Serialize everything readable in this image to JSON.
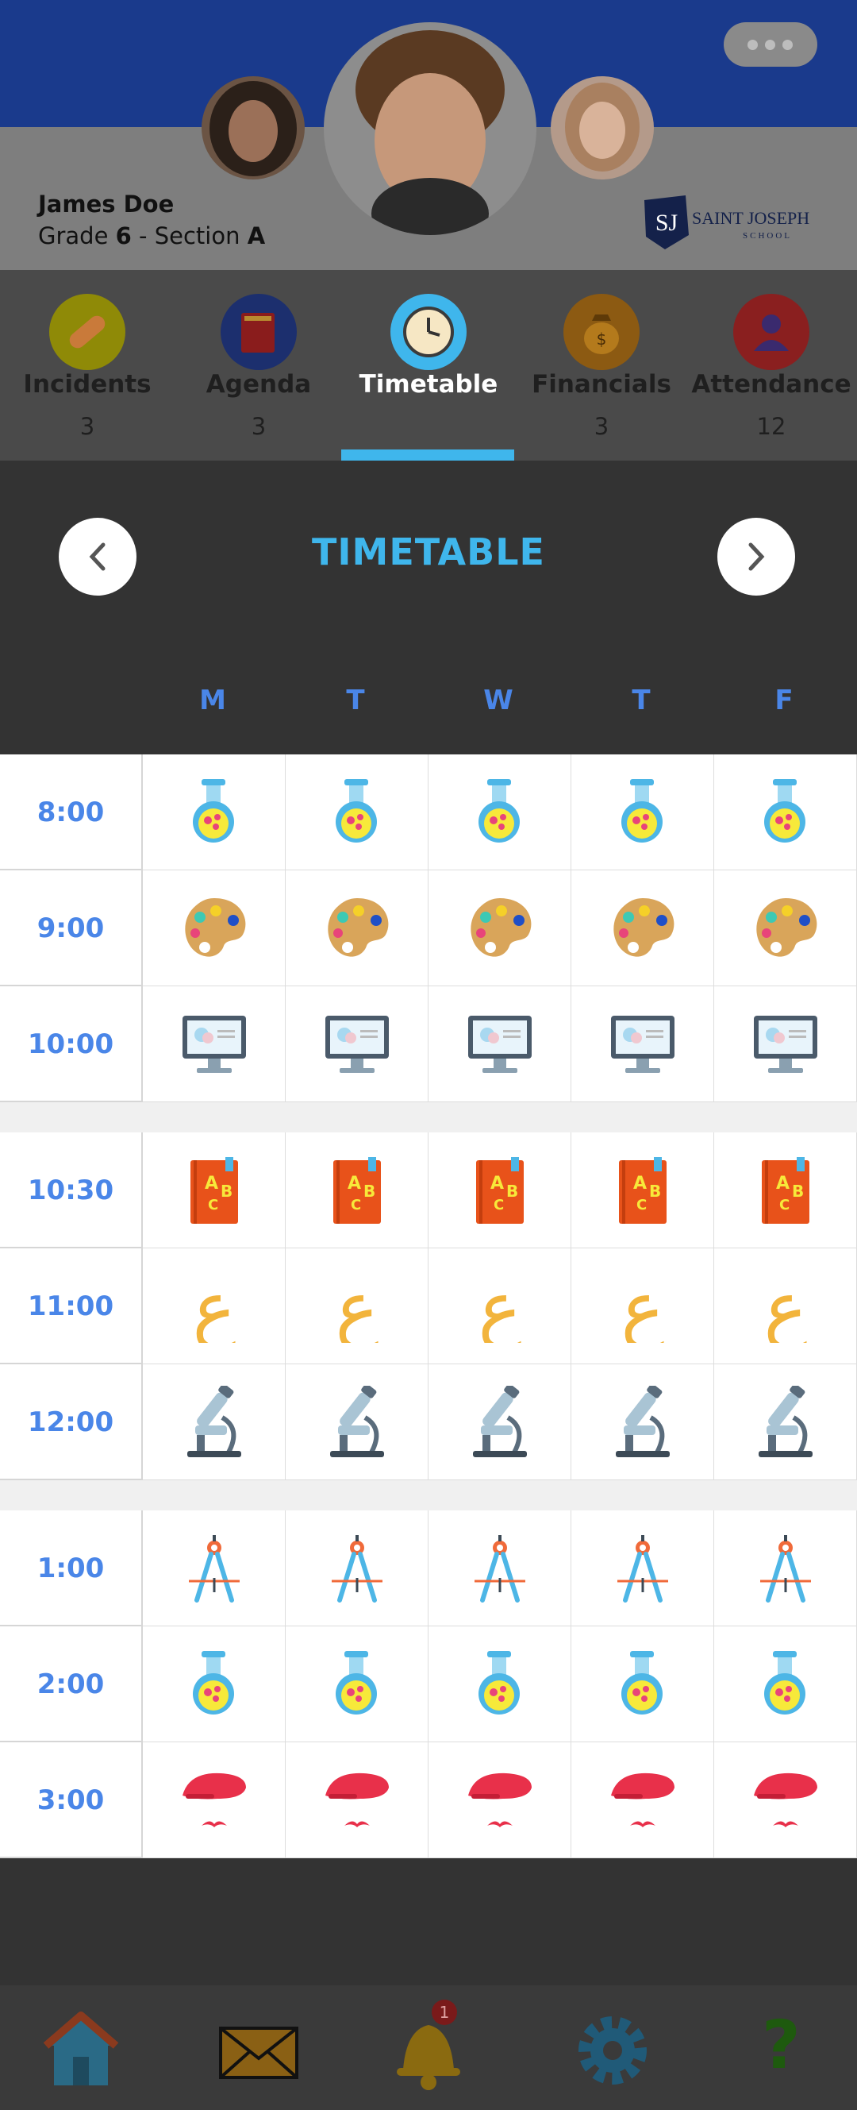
{
  "header": {
    "student_name": "James Doe",
    "grade_prefix": "Grade ",
    "grade": "6",
    "section_prefix": " - Section ",
    "section": "A",
    "school_logo_initials": "SJ",
    "school_name": "SAINT JOSEPH",
    "school_sub": "SCHOOL"
  },
  "tabs": [
    {
      "label": "Incidents",
      "count": "3",
      "icon": "bandage-icon"
    },
    {
      "label": "Agenda",
      "count": "3",
      "icon": "book-icon"
    },
    {
      "label": "Timetable",
      "count": "",
      "icon": "clock-icon",
      "active": true
    },
    {
      "label": "Financials",
      "count": "3",
      "icon": "money-bag-icon"
    },
    {
      "label": "Attendance",
      "count": "12",
      "icon": "person-icon"
    }
  ],
  "timetable": {
    "title": "TIMETABLE",
    "prev_icon": "chevron-left-icon",
    "next_icon": "chevron-right-icon",
    "days": [
      "M",
      "T",
      "W",
      "T",
      "F"
    ],
    "times": [
      "8:00",
      "9:00",
      "10:00",
      "10:30",
      "11:00",
      "12:00",
      "1:00",
      "2:00",
      "3:00"
    ],
    "subjects": [
      "flask-icon",
      "palette-icon",
      "computer-icon",
      "abc-book-icon",
      "arabic-letter-icon",
      "microscope-icon",
      "compass-icon",
      "flask-icon",
      "beret-mustache-icon"
    ],
    "arabic_letter": "ع"
  },
  "bottom_nav": {
    "items": [
      "home-icon",
      "mail-icon",
      "bell-icon",
      "settings-icon",
      "help-icon"
    ],
    "notification_count": "1",
    "help_glyph": "?"
  },
  "colors": {
    "accent": "#3fb6ec",
    "day_blue": "#4a86e8",
    "header_blue": "#1a3a8c"
  }
}
